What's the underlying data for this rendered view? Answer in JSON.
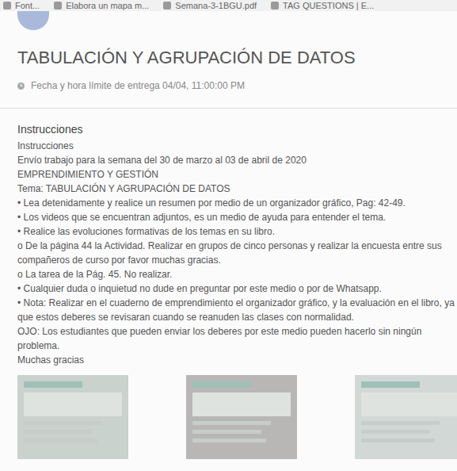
{
  "bookmarks": [
    {
      "label": "Font..."
    },
    {
      "label": "Elabora un mapa m..."
    },
    {
      "label": "Semana-3-1BGU.pdf"
    },
    {
      "label": "TAG QUESTIONS | E..."
    }
  ],
  "assignment": {
    "title": "TABULACIÓN Y AGRUPACIÓN DE DATOS",
    "due": "Fecha y hora límite de entrega 04/04, 11:00:00 PM"
  },
  "instructions": {
    "heading": "Instrucciones",
    "lines": [
      "Instrucciones",
      "Envío trabajo para la semana del 30 de marzo al 03 de abril de 2020",
      "EMPRENDIMIENTO Y GESTIÓN",
      "Tema: TABULACIÓN Y AGRUPACIÓN DE DATOS",
      "• Lea detenidamente y realice un resumen por medio de un organizador gráfico, Pag: 42-49.",
      "• Los videos que se encuentran adjuntos, es un medio de ayuda para entender el tema.",
      "• Realice las evoluciones formativas de los temas en su libro.",
      "o De la página 44 la Actividad. Realizar en grupos de cinco personas y realizar la encuesta entre sus compañeros de curso por favor muchas gracias.",
      "o La tarea de la Pág. 45. No realizar.",
      "• Cualquier duda o inquietud no dude en preguntar por este medio o por de Whatsapp.",
      "• Nota: Realizar en el cuaderno de emprendimiento el organizador gráfico, y la evaluación en el libro, ya que estos deberes se revisaran cuando se reanuden las clases con normalidad.",
      "OJO: Los estudiantes que pueden enviar los deberes por este medio pueden hacerlo sin ningún problema.",
      "Muchas gracias"
    ]
  }
}
